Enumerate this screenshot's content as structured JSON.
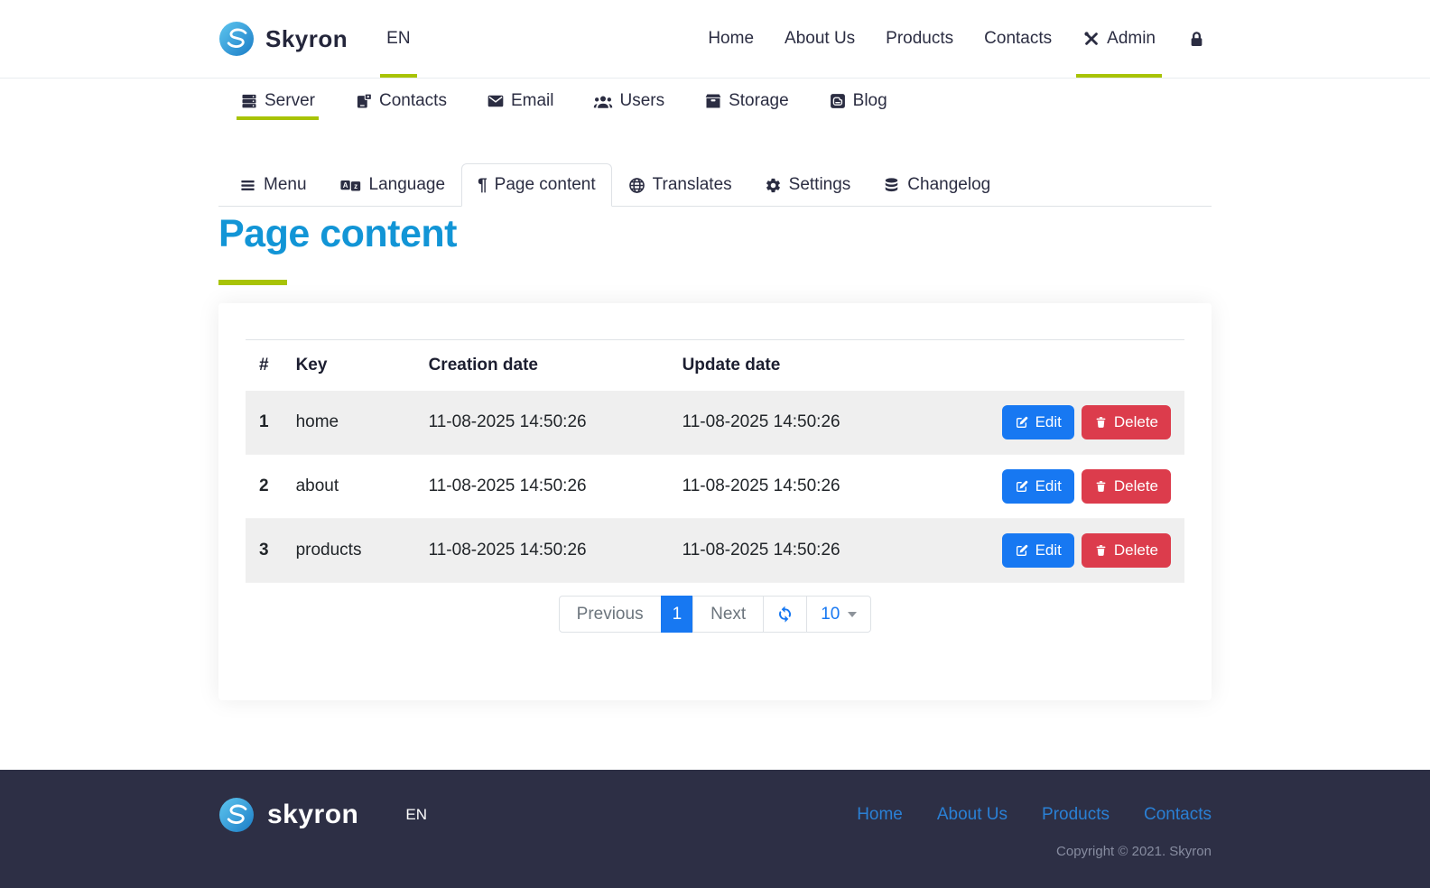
{
  "brand": {
    "name": "Skyron",
    "footer_name": "skyron",
    "lang": "EN"
  },
  "navbar": {
    "links": [
      {
        "label": "Home"
      },
      {
        "label": "About Us"
      },
      {
        "label": "Products"
      },
      {
        "label": "Contacts"
      }
    ],
    "admin_label": "Admin"
  },
  "subnav": {
    "items": [
      {
        "label": "Server",
        "icon": "server-icon",
        "active": true
      },
      {
        "label": "Contacts",
        "icon": "contacts-icon",
        "active": false
      },
      {
        "label": "Email",
        "icon": "email-icon",
        "active": false
      },
      {
        "label": "Users",
        "icon": "users-icon",
        "active": false
      },
      {
        "label": "Storage",
        "icon": "storage-icon",
        "active": false
      },
      {
        "label": "Blog",
        "icon": "blog-icon",
        "active": false
      }
    ]
  },
  "tabs": {
    "items": [
      {
        "label": "Menu",
        "icon": "menu-icon",
        "active": false
      },
      {
        "label": "Language",
        "icon": "language-icon",
        "active": false
      },
      {
        "label": "Page content",
        "icon": "pilcrow-icon",
        "active": true
      },
      {
        "label": "Translates",
        "icon": "globe-icon",
        "active": false
      },
      {
        "label": "Settings",
        "icon": "gear-icon",
        "active": false
      },
      {
        "label": "Changelog",
        "icon": "database-icon",
        "active": false
      }
    ]
  },
  "page": {
    "title": "Page content"
  },
  "table": {
    "headers": {
      "num": "#",
      "key": "Key",
      "created": "Creation date",
      "updated": "Update date"
    },
    "rows": [
      {
        "num": "1",
        "key": "home",
        "created": "11-08-2025 14:50:26",
        "updated": "11-08-2025 14:50:26"
      },
      {
        "num": "2",
        "key": "about",
        "created": "11-08-2025 14:50:26",
        "updated": "11-08-2025 14:50:26"
      },
      {
        "num": "3",
        "key": "products",
        "created": "11-08-2025 14:50:26",
        "updated": "11-08-2025 14:50:26"
      }
    ],
    "edit_label": "Edit",
    "delete_label": "Delete"
  },
  "pagination": {
    "previous": "Previous",
    "page": "1",
    "next": "Next",
    "per_page": "10"
  },
  "footer": {
    "links": [
      {
        "label": "Home"
      },
      {
        "label": "About Us"
      },
      {
        "label": "Products"
      },
      {
        "label": "Contacts"
      }
    ],
    "copyright": "Copyright © 2021. Skyron"
  },
  "colors": {
    "accent_green": "#a8c306",
    "title_blue": "#1295d6",
    "primary_blue": "#1778f2",
    "danger_red": "#dc3c4c",
    "navy": "#2b2d42",
    "footer_bg": "#2d2f45",
    "footer_link_blue": "#2a80d5"
  }
}
